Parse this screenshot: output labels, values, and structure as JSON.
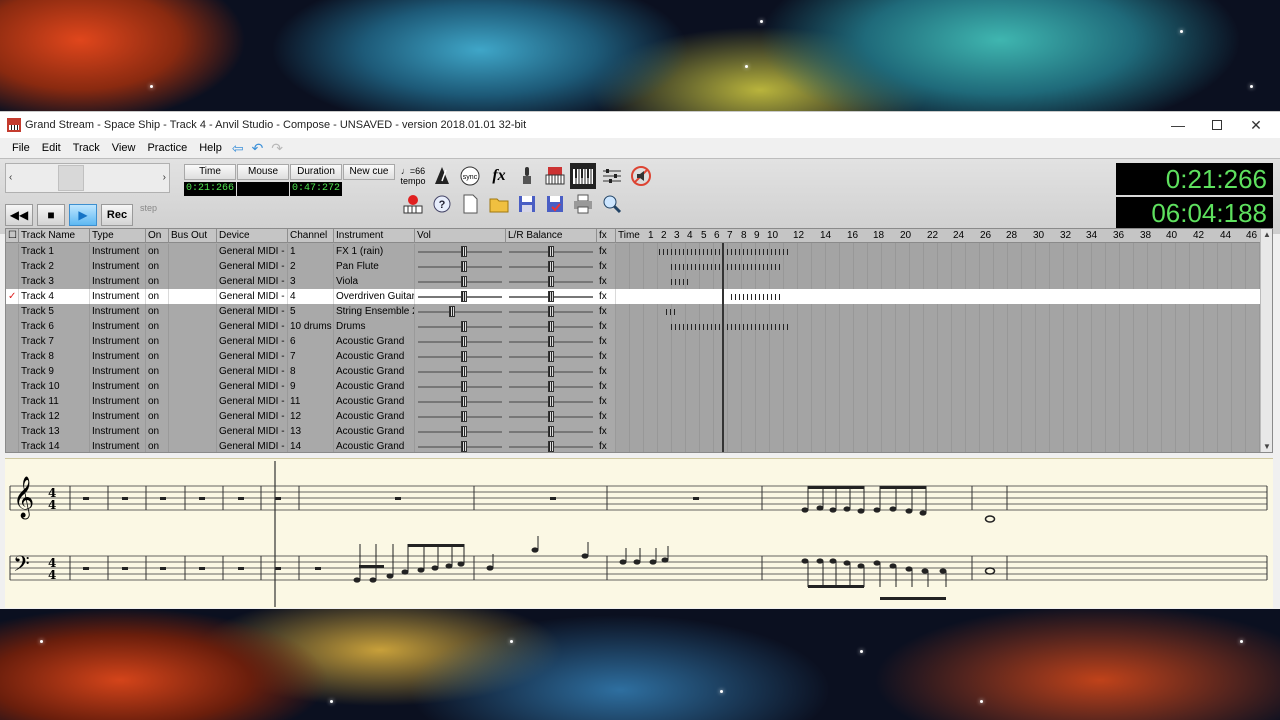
{
  "window": {
    "title": "Grand Stream - Space Ship - Track 4 - Anvil Studio - Compose - UNSAVED - version 2018.01.01 32-bit",
    "controls": {
      "minimize": "—",
      "maximize": "",
      "close": "✕"
    }
  },
  "menu": [
    "File",
    "Edit",
    "Track",
    "View",
    "Practice",
    "Help"
  ],
  "toolbar": {
    "counters": [
      {
        "label": "Time",
        "value": "0:21:266"
      },
      {
        "label": "Mouse",
        "value": ""
      },
      {
        "label": "Duration",
        "value": "0:47:272"
      },
      {
        "label": "New cue",
        "value": ""
      }
    ],
    "transport": {
      "rec_label": "Rec",
      "step_label": "step"
    },
    "tempo_value": "♩=66",
    "tempo_label": "tempo",
    "sync_label": "sync",
    "fx_label": "fx",
    "clock_time": "0:21:266",
    "clock_total": "06:04:188"
  },
  "tracks": {
    "columns": [
      "Track Name",
      "Type",
      "On",
      "Bus Out",
      "Device",
      "Channel",
      "Instrument",
      "Vol",
      "L/R Balance",
      "fx",
      "Time"
    ],
    "timeline_numbers": [
      "1",
      "2",
      "3",
      "4",
      "5",
      "6",
      "7",
      "8",
      "9",
      "10",
      "12",
      "14",
      "16",
      "18",
      "20",
      "22",
      "24",
      "26",
      "28",
      "30",
      "32",
      "34",
      "36",
      "38",
      "40",
      "42",
      "44",
      "46"
    ],
    "rows": [
      {
        "name": "Track 1",
        "type": "Instrument",
        "on": "on",
        "device": "General MIDI - M",
        "channel": "1",
        "instrument": "FX 1 (rain)",
        "vol": 0.55,
        "fx": "fx"
      },
      {
        "name": "Track 2",
        "type": "Instrument",
        "on": "on",
        "device": "General MIDI - M",
        "channel": "2",
        "instrument": "Pan Flute",
        "vol": 0.55,
        "fx": "fx"
      },
      {
        "name": "Track 3",
        "type": "Instrument",
        "on": "on",
        "device": "General MIDI - M",
        "channel": "3",
        "instrument": "Viola",
        "vol": 0.55,
        "fx": "fx"
      },
      {
        "name": "Track 4",
        "type": "Instrument",
        "on": "on",
        "device": "General MIDI - M",
        "channel": "4",
        "instrument": "Overdriven Guitar",
        "vol": 0.55,
        "fx": "fx",
        "selected": true
      },
      {
        "name": "Track 5",
        "type": "Instrument",
        "on": "on",
        "device": "General MIDI - M",
        "channel": "5",
        "instrument": "String Ensemble 2",
        "vol": 0.4,
        "fx": "fx"
      },
      {
        "name": "Track 6",
        "type": "Instrument",
        "on": "on",
        "device": "General MIDI - M",
        "channel": "10 drums",
        "instrument": "Drums",
        "vol": 0.55,
        "fx": "fx"
      },
      {
        "name": "Track 7",
        "type": "Instrument",
        "on": "on",
        "device": "General MIDI - M",
        "channel": "6",
        "instrument": "Acoustic Grand",
        "vol": 0.55,
        "fx": "fx"
      },
      {
        "name": "Track 8",
        "type": "Instrument",
        "on": "on",
        "device": "General MIDI - M",
        "channel": "7",
        "instrument": "Acoustic Grand",
        "vol": 0.55,
        "fx": "fx"
      },
      {
        "name": "Track 9",
        "type": "Instrument",
        "on": "on",
        "device": "General MIDI - M",
        "channel": "8",
        "instrument": "Acoustic Grand",
        "vol": 0.55,
        "fx": "fx"
      },
      {
        "name": "Track 10",
        "type": "Instrument",
        "on": "on",
        "device": "General MIDI - M",
        "channel": "9",
        "instrument": "Acoustic Grand",
        "vol": 0.55,
        "fx": "fx"
      },
      {
        "name": "Track 11",
        "type": "Instrument",
        "on": "on",
        "device": "General MIDI - M",
        "channel": "11",
        "instrument": "Acoustic Grand",
        "vol": 0.55,
        "fx": "fx"
      },
      {
        "name": "Track 12",
        "type": "Instrument",
        "on": "on",
        "device": "General MIDI - M",
        "channel": "12",
        "instrument": "Acoustic Grand",
        "vol": 0.55,
        "fx": "fx"
      },
      {
        "name": "Track 13",
        "type": "Instrument",
        "on": "on",
        "device": "General MIDI - M",
        "channel": "13",
        "instrument": "Acoustic Grand",
        "vol": 0.55,
        "fx": "fx"
      },
      {
        "name": "Track 14",
        "type": "Instrument",
        "on": "on",
        "device": "General MIDI - M",
        "channel": "14",
        "instrument": "Acoustic Grand",
        "vol": 0.55,
        "fx": "fx"
      }
    ]
  },
  "score": {
    "time_signature_top": "4",
    "time_signature_bottom": "4"
  }
}
